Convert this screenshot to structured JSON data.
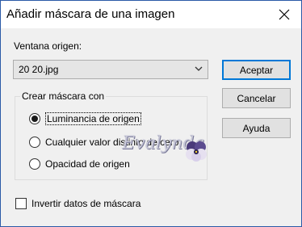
{
  "dialog": {
    "title": "Añadir máscara de una imagen"
  },
  "source": {
    "label": "Ventana origen:",
    "selected": "20 20.jpg"
  },
  "buttons": {
    "accept": "Aceptar",
    "cancel": "Cancelar",
    "help": "Ayuda"
  },
  "mask_group": {
    "label": "Crear máscara con",
    "options": [
      {
        "label": "Luminancia de origen",
        "selected": true
      },
      {
        "label": "Cualquier valor distinto de cero",
        "selected": false
      },
      {
        "label": "Opacidad de origen",
        "selected": false
      }
    ]
  },
  "invert": {
    "label": "Invertir datos de máscara",
    "checked": false
  },
  "watermark": {
    "text": "Evalynda"
  },
  "colors": {
    "accent": "#0078d7",
    "window_border": "#2b5aa7"
  }
}
